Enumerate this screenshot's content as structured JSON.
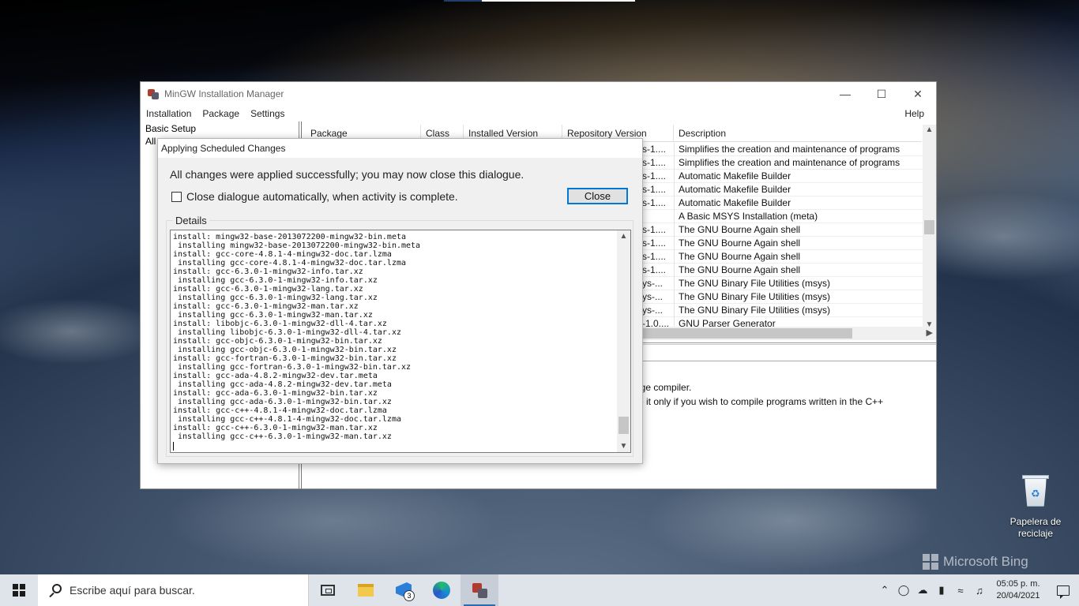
{
  "main_window": {
    "title": "MinGW Installation Manager",
    "menu": [
      "Installation",
      "Package",
      "Settings"
    ],
    "help": "Help",
    "left_pane": {
      "item1": "Basic Setup",
      "item2": "All"
    },
    "columns": [
      "Package",
      "Class",
      "Installed Version",
      "Repository Version",
      "Description"
    ],
    "rows": [
      {
        "repo": "s-1....",
        "desc": "Simplifies the creation and maintenance of programs"
      },
      {
        "repo": "s-1....",
        "desc": "Simplifies the creation and maintenance of programs"
      },
      {
        "repo": "s-1....",
        "desc": "Automatic Makefile Builder"
      },
      {
        "repo": "s-1....",
        "desc": "Automatic Makefile Builder"
      },
      {
        "repo": "s-1....",
        "desc": "Automatic Makefile Builder"
      },
      {
        "repo": "",
        "desc": "A Basic MSYS Installation (meta)"
      },
      {
        "repo": "s-1....",
        "desc": "The GNU Bourne Again shell"
      },
      {
        "repo": "s-1....",
        "desc": "The GNU Bourne Again shell"
      },
      {
        "repo": "s-1....",
        "desc": "The GNU Bourne Again shell"
      },
      {
        "repo": "s-1....",
        "desc": "The GNU Bourne Again shell"
      },
      {
        "repo": "ys-...",
        "desc": "The GNU Binary File Utilities (msys)"
      },
      {
        "repo": "ys-...",
        "desc": "The GNU Binary File Utilities (msys)"
      },
      {
        "repo": "ys-...",
        "desc": "The GNU Binary File Utilities (msys)"
      },
      {
        "repo": "-1.0....",
        "desc": "GNU Parser Generator"
      }
    ],
    "description_line1": "age compiler.",
    "description_line2": "re it only if you wish to compile programs written in the C++"
  },
  "dialog": {
    "title": "Applying Scheduled Changes",
    "message": "All changes were applied successfully; you may now close this dialogue.",
    "checkbox_label": "Close dialogue automatically, when activity is complete.",
    "close_button": "Close",
    "details_label": "Details",
    "log": [
      "install: mingw32-base-2013072200-mingw32-bin.meta",
      " installing mingw32-base-2013072200-mingw32-bin.meta",
      "install: gcc-core-4.8.1-4-mingw32-doc.tar.lzma",
      " installing gcc-core-4.8.1-4-mingw32-doc.tar.lzma",
      "install: gcc-6.3.0-1-mingw32-info.tar.xz",
      " installing gcc-6.3.0-1-mingw32-info.tar.xz",
      "install: gcc-6.3.0-1-mingw32-lang.tar.xz",
      " installing gcc-6.3.0-1-mingw32-lang.tar.xz",
      "install: gcc-6.3.0-1-mingw32-man.tar.xz",
      " installing gcc-6.3.0-1-mingw32-man.tar.xz",
      "install: libobjc-6.3.0-1-mingw32-dll-4.tar.xz",
      " installing libobjc-6.3.0-1-mingw32-dll-4.tar.xz",
      "install: gcc-objc-6.3.0-1-mingw32-bin.tar.xz",
      " installing gcc-objc-6.3.0-1-mingw32-bin.tar.xz",
      "install: gcc-fortran-6.3.0-1-mingw32-bin.tar.xz",
      " installing gcc-fortran-6.3.0-1-mingw32-bin.tar.xz",
      "install: gcc-ada-4.8.2-mingw32-dev.tar.meta",
      " installing gcc-ada-4.8.2-mingw32-dev.tar.meta",
      "install: gcc-ada-6.3.0-1-mingw32-bin.tar.xz",
      " installing gcc-ada-6.3.0-1-mingw32-bin.tar.xz",
      "install: gcc-c++-4.8.1-4-mingw32-doc.tar.lzma",
      " installing gcc-c++-4.8.1-4-mingw32-doc.tar.lzma",
      "install: gcc-c++-6.3.0-1-mingw32-man.tar.xz",
      " installing gcc-c++-6.3.0-1-mingw32-man.tar.xz"
    ]
  },
  "desktop": {
    "recycle_bin_label": "Papelera de reciclaje",
    "bing_watermark": "Microsoft Bing"
  },
  "taskbar": {
    "search_placeholder": "Escribe aquí para buscar.",
    "vscode_badge": "3",
    "time": "05:05 p. m.",
    "date": "20/04/2021",
    "icons": [
      "windows-start-icon",
      "search-icon",
      "task-view-icon",
      "file-explorer-icon",
      "vscode-icon",
      "edge-icon",
      "mingw-icon",
      "chevron-up-icon",
      "meet-now-icon",
      "onedrive-icon",
      "battery-icon",
      "wifi-icon",
      "volume-icon",
      "notification-icon"
    ]
  }
}
